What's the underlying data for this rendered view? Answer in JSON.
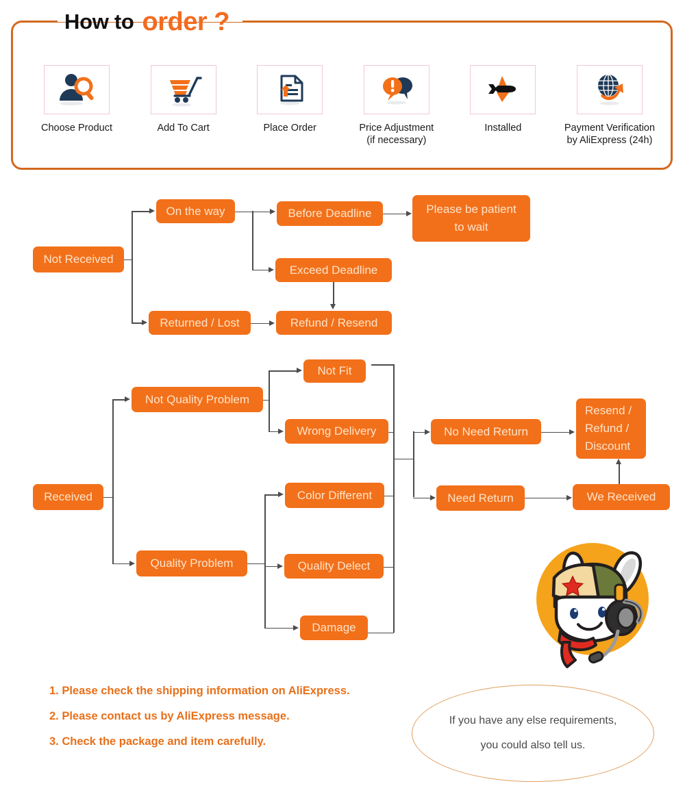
{
  "header": {
    "title_black": "How to",
    "title_orange": "order ?",
    "frame_color": "#d2691e",
    "accent_color": "#f26b1f"
  },
  "steps": [
    {
      "icon": "person-search-icon",
      "label": "Choose Product"
    },
    {
      "icon": "shopping-cart-icon",
      "label": "Add To Cart"
    },
    {
      "icon": "document-upload-icon",
      "label": "Place Order"
    },
    {
      "icon": "speech-bubbles-alert-icon",
      "label": "Price Adjustment\n(if necessary)",
      "label_line1": "Price Adjustment",
      "label_line2": "(if necessary)"
    },
    {
      "icon": "airplane-icon",
      "label": "Installed"
    },
    {
      "icon": "globe-arrow-icon",
      "label": "Payment Verification\nby AliExpress (24h)",
      "label_line1": "Payment Verification",
      "label_line2": "by AliExpress (24h)"
    }
  ],
  "flow_not_received": {
    "root": "Not Received",
    "on_the_way": "On the way",
    "before_deadline": "Before Deadline",
    "please_wait_line1": "Please be patient",
    "please_wait_line2": "to wait",
    "exceed_deadline": "Exceed Deadline",
    "returned_lost": "Returned / Lost",
    "refund_resend": "Refund / Resend"
  },
  "flow_received": {
    "root": "Received",
    "not_quality_problem": "Not Quality Problem",
    "quality_problem": "Quality Problem",
    "not_fit": "Not Fit",
    "wrong_delivery": "Wrong Delivery",
    "color_different": "Color Different",
    "quality_delect": "Quality Delect",
    "damage": "Damage",
    "no_need_return": "No Need Return",
    "need_return": "Need Return",
    "resend_line1": "Resend /",
    "resend_line2": "Refund /",
    "resend_line3": "Discount",
    "we_received": "We Received"
  },
  "notes": [
    "1. Please check the shipping information on AliExpress.",
    "2. Please contact us by AliExpress message.",
    "3. Check the package and item carefully."
  ],
  "oval": {
    "line1": "If you have any else requirements,",
    "line2": "you could also tell us."
  },
  "colors": {
    "box_orange": "#f2701a",
    "box_text": "#ffe3c9",
    "connector": "#4d4d4d",
    "note_orange": "#e8701a",
    "oval_border": "#e0a060",
    "icon_navy": "#1f3a57",
    "icon_orange": "#f2701a",
    "mascot_circle": "#f5a31b"
  }
}
